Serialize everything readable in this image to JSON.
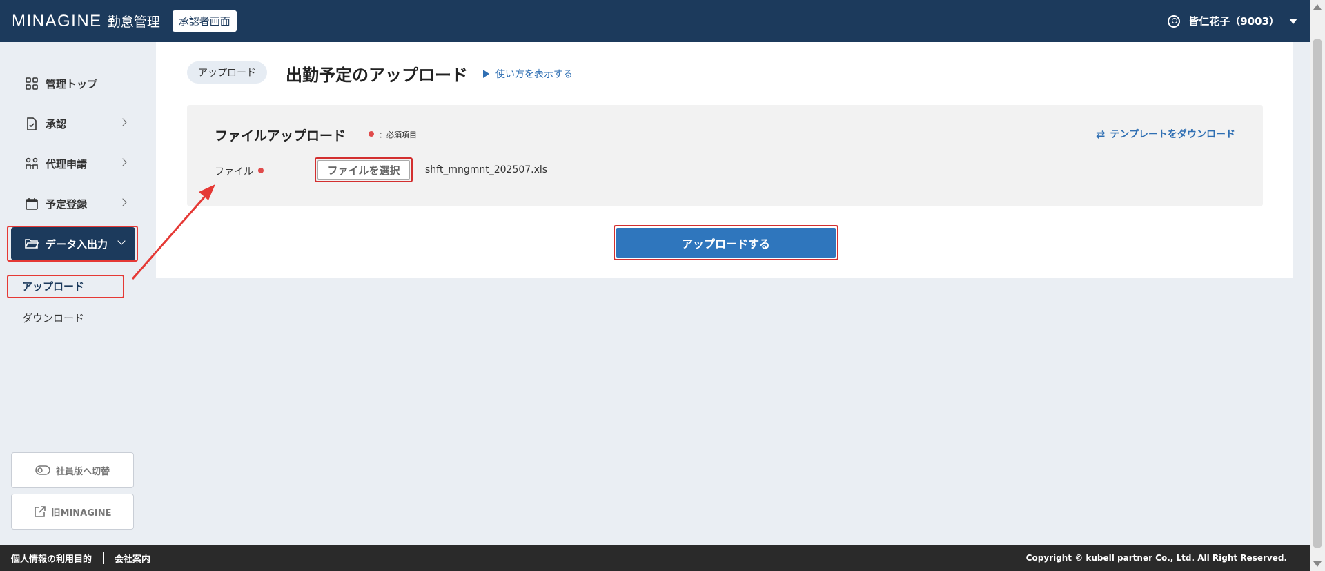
{
  "header": {
    "brand": "MINAGINE",
    "brand_sub": "勤怠管理",
    "role_badge": "承認者画面",
    "user_name": "皆仁花子（9003）"
  },
  "sidebar": {
    "items": [
      {
        "label": "管理トップ",
        "icon": "grid-icon"
      },
      {
        "label": "承認",
        "icon": "document-check-icon"
      },
      {
        "label": "代理申請",
        "icon": "people-icon"
      },
      {
        "label": "予定登録",
        "icon": "calendar-icon"
      },
      {
        "label": "データ入出力",
        "icon": "folder-icon"
      }
    ],
    "sub_items": [
      {
        "label": "アップロード"
      },
      {
        "label": "ダウンロード"
      }
    ],
    "switch_button": "社員版へ切替",
    "old_button": "旧MINAGINE"
  },
  "main": {
    "breadcrumb": "アップロード",
    "title": "出勤予定のアップロード",
    "howto_link": "使い方を表示する",
    "panel": {
      "title": "ファイルアップロード",
      "required_note": "：必須項目",
      "template_link": "テンプレートをダウンロード",
      "file_label": "ファイル",
      "choose_button": "ファイルを選択",
      "file_name": "shft_mngmnt_202507.xls"
    },
    "upload_button": "アップロードする"
  },
  "footer": {
    "privacy": "個人情報の利用目的",
    "company": "会社案内",
    "copyright": "Copyright © kubell partner Co., Ltd. All Right Reserved."
  },
  "colors": {
    "header_bg": "#1c3a5c",
    "accent_blue": "#2f76bd",
    "annotation_red": "#e53935",
    "page_bg": "#eaeef3"
  }
}
